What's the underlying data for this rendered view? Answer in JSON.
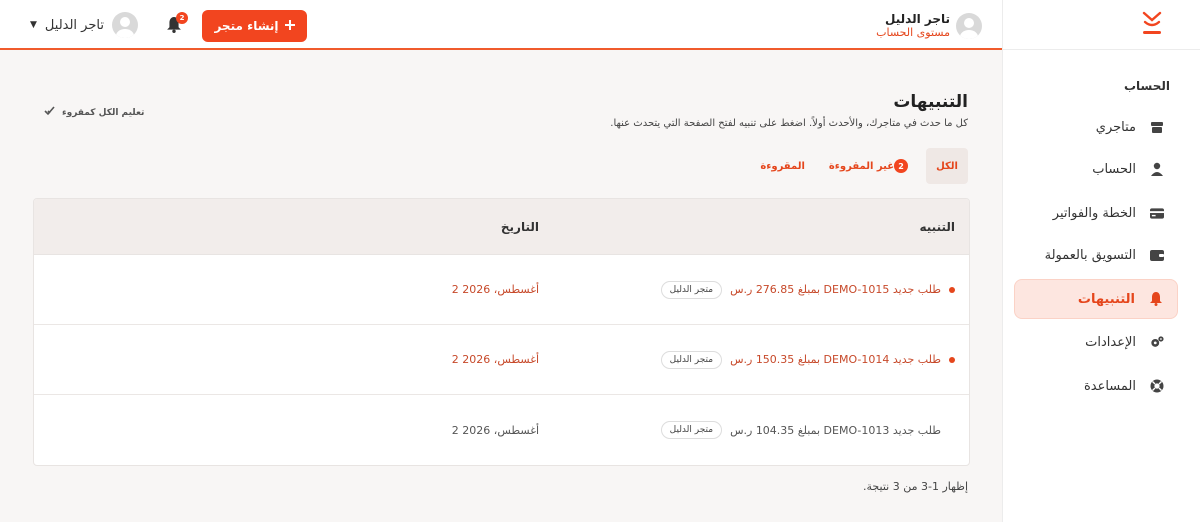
{
  "header": {
    "user_name": "تاجر الدليل",
    "user_level": "مستوى الحساب",
    "create_store_label": "إنشاء متجر",
    "notification_count": "2",
    "account_name": "تاجر الدليل"
  },
  "sidebar": {
    "section_label": "الحساب",
    "items": [
      {
        "label": "متاجري",
        "icon": "store-icon"
      },
      {
        "label": "الحساب",
        "icon": "user-icon"
      },
      {
        "label": "الخطة والفواتير",
        "icon": "card-icon"
      },
      {
        "label": "التسويق بالعمولة",
        "icon": "wallet-icon"
      },
      {
        "label": "التنبيهات",
        "icon": "bell-icon"
      },
      {
        "label": "الإعدادات",
        "icon": "gears-icon"
      },
      {
        "label": "المساعدة",
        "icon": "lifebuoy-icon"
      }
    ],
    "active_index": 4
  },
  "main": {
    "title": "التنبيهات",
    "subtitle": "كل ما حدث في متاجرك، والأحدث أولاً. اضغط على تنبيه لفتح الصفحة التي يتحدث عنها.",
    "mark_all_label": "تعليم الكل كمقروء",
    "tabs": [
      {
        "label": "الكل"
      },
      {
        "label": "غير المقروءة",
        "badge": "2"
      },
      {
        "label": "المقروءة"
      }
    ],
    "table": {
      "headers": {
        "notification": "التنبيه",
        "date": "التاريخ"
      },
      "rows": [
        {
          "text": "طلب جديد DEMO-1015 بمبلغ 276.85 ر.س",
          "store": "متجر الدليل",
          "date": "2 أغسطس، 2026",
          "unread": true
        },
        {
          "text": "طلب جديد DEMO-1014 بمبلغ 150.35 ر.س",
          "store": "متجر الدليل",
          "date": "2 أغسطس، 2026",
          "unread": true
        },
        {
          "text": "طلب جديد DEMO-1013 بمبلغ 104.35 ر.س",
          "store": "متجر الدليل",
          "date": "2 أغسطس، 2026",
          "unread": false
        }
      ]
    },
    "results_text": "إظهار 1-3 من 3 نتيجة."
  },
  "colors": {
    "accent": "#f2451f",
    "active_bg": "#fde6e0"
  }
}
